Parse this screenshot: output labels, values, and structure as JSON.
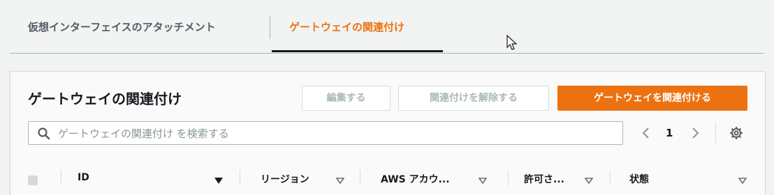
{
  "tabs": {
    "tab1": "仮想インターフェイスのアタッチメント",
    "tab2": "ゲートウェイの関連付け"
  },
  "panel": {
    "title": "ゲートウェイの関連付け",
    "buttons": {
      "edit": "編集する",
      "disassociate": "関連付けを解除する",
      "associate": "ゲートウェイを関連付ける"
    },
    "search": {
      "placeholder": "ゲートウェイの関連付け を検索する"
    },
    "pagination": {
      "page": "1"
    }
  },
  "table": {
    "columns": [
      "ID",
      "リージョン",
      "AWS アカウ...",
      "許可さ...",
      "状態"
    ]
  },
  "colors": {
    "accent": "#ec7211",
    "text": "#16191f",
    "border": "#aab7b8"
  },
  "icons": [
    "search-icon",
    "chevron-left-icon",
    "chevron-right-icon",
    "settings-gear-icon",
    "sort-down-icon",
    "mouse-pointer-icon"
  ]
}
